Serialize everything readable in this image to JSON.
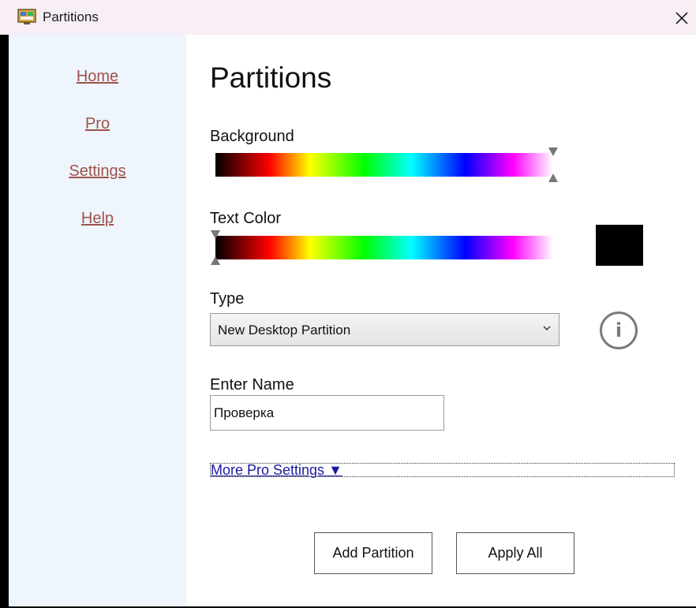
{
  "window": {
    "title": "Partitions",
    "app_icon": "partitions-app-icon",
    "close_icon": "close-icon"
  },
  "sidebar": {
    "items": [
      {
        "label": "Home"
      },
      {
        "label": "Pro"
      },
      {
        "label": "Settings"
      },
      {
        "label": "Help"
      }
    ]
  },
  "main": {
    "title": "Partitions",
    "background": {
      "label": "Background",
      "slider_value": 1.0
    },
    "text_color": {
      "label": "Text Color",
      "slider_value": 0.0,
      "swatch_color": "#000000"
    },
    "type": {
      "label": "Type",
      "selected": "New Desktop Partition",
      "info_icon": "info-icon"
    },
    "name": {
      "label": "Enter Name",
      "value": "Проверка"
    },
    "more_settings": {
      "label": "More Pro Settings ▼"
    },
    "buttons": {
      "add": "Add Partition",
      "apply": "Apply All"
    }
  },
  "colors": {
    "link": "#a0524a",
    "pro_link": "#1a1aa0",
    "sidebar_bg": "#eef5fc",
    "titlebar_bg": "#f7eef6"
  }
}
